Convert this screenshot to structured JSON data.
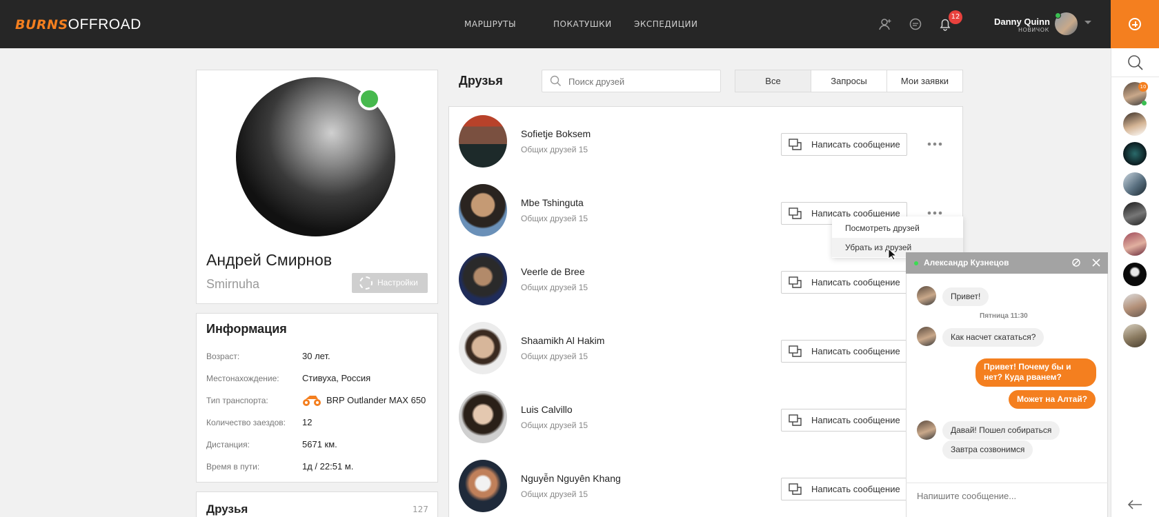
{
  "header": {
    "logo_brand": "BURNS",
    "logo_text": "OFFROAD",
    "nav": [
      "МАРШРУТЫ",
      "ПОКАТУШКИ",
      "ЭКСПЕДИЦИИ"
    ],
    "notifications_count": "12",
    "user": {
      "name": "Danny Quinn",
      "rank": "НОВИЧОК"
    }
  },
  "sidebar": {
    "unread_badge": "10"
  },
  "profile": {
    "name": "Андрей Смирнов",
    "nickname": "Smirnuha",
    "settings_label": "Настройки"
  },
  "info": {
    "title": "Информация",
    "rows": [
      {
        "label": "Возраст:",
        "value": "30 лет."
      },
      {
        "label": "Местонахождение:",
        "value": "Стивуха, Россия"
      },
      {
        "label": "Тип транспорта:",
        "value": "BRP Outlander MAX 650"
      },
      {
        "label": "Количество заездов:",
        "value": "12"
      },
      {
        "label": "Дистанция:",
        "value": "5671 км."
      },
      {
        "label": "Время в пути:",
        "value": "1д / 22:51 м."
      }
    ]
  },
  "friends_box": {
    "title": "Друзья",
    "count": "127"
  },
  "friends": {
    "title": "Друзья",
    "search_placeholder": "Поиск друзей",
    "filters": [
      "Все",
      "Запросы",
      "Мои заявки"
    ],
    "message_label": "Написать сообщение",
    "items": [
      {
        "name": "Sofietje Boksem",
        "mutual": "Общих друзей 15"
      },
      {
        "name": "Mbe Tshinguta",
        "mutual": "Общих друзей 15"
      },
      {
        "name": "Veerle de Bree",
        "mutual": "Общих друзей 15"
      },
      {
        "name": "Shaamikh Al Hakim",
        "mutual": "Общих друзей 15"
      },
      {
        "name": "Luis Calvillo",
        "mutual": "Общих друзей 15"
      },
      {
        "name": "Nguyễn Nguyên Khang",
        "mutual": "Общих друзей 15"
      }
    ],
    "dropdown": [
      "Посмотреть друзей",
      "Убрать из друзей"
    ]
  },
  "chat": {
    "title": "Александр Кузнецов",
    "date": "Пятница 11:30",
    "messages": [
      "Привет!",
      "Как насчет скататься?",
      "Привет! Почему бы и",
      "нет? Куда рванем?",
      "Может на Алтай?",
      "Давай! Пошел собираться",
      "Завтра созвонимся"
    ],
    "input_placeholder": "Напишите сообщение..."
  },
  "colors": {
    "accent": "#f47f1f",
    "header": "#262626",
    "online": "#46b94d",
    "badge": "#e8413d"
  }
}
